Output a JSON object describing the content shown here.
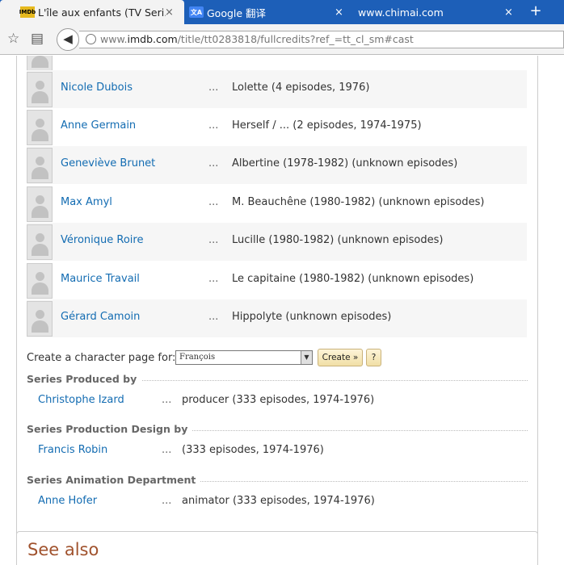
{
  "browser": {
    "tabs": [
      {
        "favicon": "IMDb",
        "title": "L'île aux enfants (TV Seri...",
        "close": "×"
      },
      {
        "favicon": "文A",
        "title": "Google 翻译",
        "close": "×"
      },
      {
        "favicon": "",
        "title": "www.chimai.com",
        "close": "×"
      }
    ],
    "new_tab": "+",
    "url_prefix": "www.",
    "url_host": "imdb.com",
    "url_path": "/title/tt0283818/fullcredits?ref_=tt_cl_sm#cast"
  },
  "cast": [
    {
      "name": "Nicole Dubois",
      "dots": "...",
      "role": "Lolette (4 episodes, 1976)"
    },
    {
      "name": "Anne Germain",
      "dots": "...",
      "role": "Herself / ... (2 episodes, 1974-1975)"
    },
    {
      "name": "Geneviève Brunet",
      "dots": "...",
      "role": "Albertine (1978-1982) (unknown episodes)"
    },
    {
      "name": "Max Amyl",
      "dots": "...",
      "role": "M. Beauchêne (1980-1982) (unknown episodes)"
    },
    {
      "name": "Véronique Roire",
      "dots": "...",
      "role": "Lucille (1980-1982) (unknown episodes)"
    },
    {
      "name": "Maurice Travail",
      "dots": "...",
      "role": "Le capitaine (1980-1982) (unknown episodes)"
    },
    {
      "name": "Gérard Camoin",
      "dots": "...",
      "role": "Hippolyte (unknown episodes)"
    }
  ],
  "char_page": {
    "label": "Create a character page for:",
    "selected": "François",
    "create_label": "Create »",
    "help_label": "?"
  },
  "sections": [
    {
      "heading": "Series Produced by",
      "name": "Christophe Izard",
      "dots": "...",
      "role": "producer (333 episodes, 1974-1976)"
    },
    {
      "heading": "Series Production Design by",
      "name": "Francis Robin",
      "dots": "...",
      "role": "(333 episodes, 1974-1976)"
    },
    {
      "heading": "Series Animation Department",
      "name": "Anne Hofer",
      "dots": "...",
      "role": "animator (333 episodes, 1974-1976)"
    }
  ],
  "see_also": "See also"
}
